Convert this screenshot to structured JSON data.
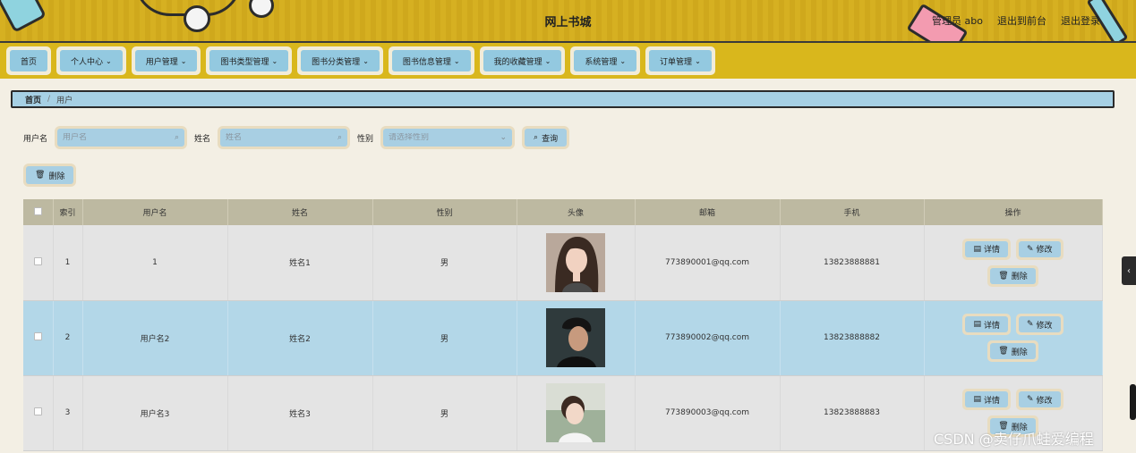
{
  "header": {
    "title": "网上书城",
    "admin": "管理员 abo",
    "to_front": "退出到前台",
    "logout": "退出登录"
  },
  "nav": {
    "items": [
      {
        "label": "首页",
        "caret": false
      },
      {
        "label": "个人中心",
        "caret": true
      },
      {
        "label": "用户管理",
        "caret": true
      },
      {
        "label": "图书类型管理",
        "caret": true
      },
      {
        "label": "图书分类管理",
        "caret": true
      },
      {
        "label": "图书信息管理",
        "caret": true
      },
      {
        "label": "我的收藏管理",
        "caret": true
      },
      {
        "label": "系统管理",
        "caret": true
      },
      {
        "label": "订单管理",
        "caret": true
      }
    ]
  },
  "breadcrumb": {
    "home": "首页",
    "separator": "/",
    "current": "用户"
  },
  "search": {
    "username_label": "用户名",
    "username_placeholder": "用户名",
    "name_label": "姓名",
    "name_placeholder": "姓名",
    "gender_label": "性别",
    "gender_placeholder": "请选择性别",
    "query_button": "查询",
    "delete_button": "删除"
  },
  "table": {
    "columns": [
      "索引",
      "用户名",
      "姓名",
      "性别",
      "头像",
      "邮箱",
      "手机",
      "操作"
    ],
    "rows": [
      {
        "index": "1",
        "username": "1",
        "name": "姓名1",
        "gender": "男",
        "email": "773890001@qq.com",
        "phone": "13823888881"
      },
      {
        "index": "2",
        "username": "用户名2",
        "name": "姓名2",
        "gender": "男",
        "email": "773890002@qq.com",
        "phone": "13823888882"
      },
      {
        "index": "3",
        "username": "用户名3",
        "name": "姓名3",
        "gender": "男",
        "email": "773890003@qq.com",
        "phone": "13823888883"
      }
    ],
    "actions": {
      "detail": "详情",
      "edit": "修改",
      "delete": "删除"
    }
  },
  "watermark": "CSDN @卖仔爪蛙爱编程",
  "colors": {
    "header_bg": "#d6b021",
    "nav_bg": "#d9b71c",
    "button_fill": "#a8cfe3",
    "button_border": "#e8dcc0",
    "row_highlight": "#b3d7e8",
    "table_header": "#bdb9a1"
  }
}
